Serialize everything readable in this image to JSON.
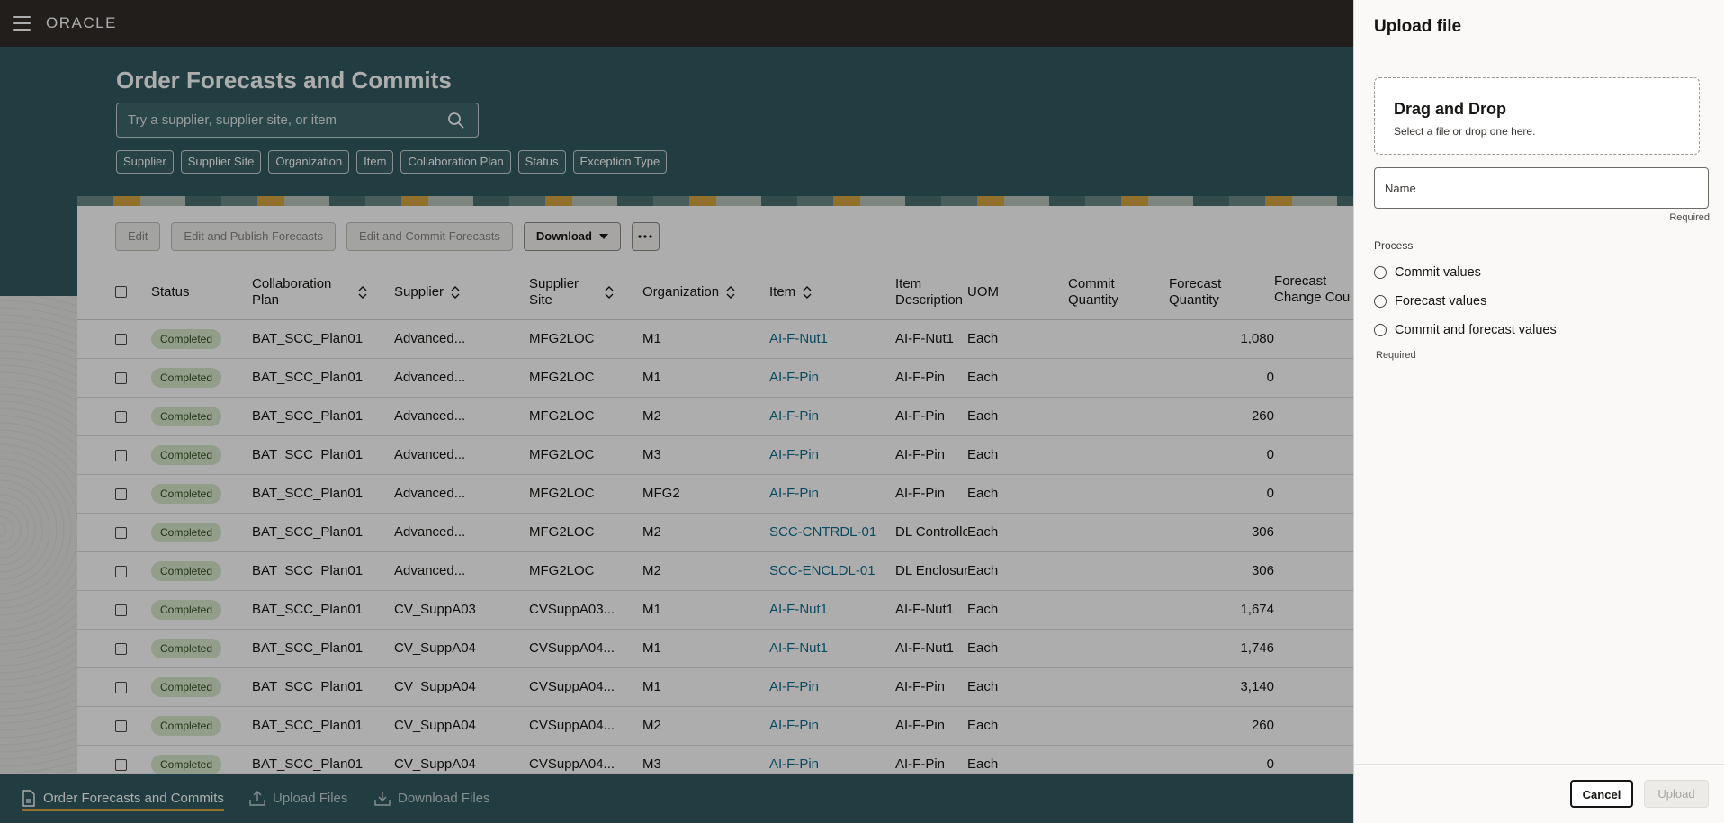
{
  "topbar": {
    "logo": "ORACLE"
  },
  "page": {
    "title": "Order Forecasts and Commits",
    "search_placeholder": "Try a supplier, supplier site, or item"
  },
  "filters": [
    "Supplier",
    "Supplier Site",
    "Organization",
    "Item",
    "Collaboration Plan",
    "Status",
    "Exception Type"
  ],
  "toolbar": {
    "edit": "Edit",
    "edit_publish": "Edit and Publish Forecasts",
    "edit_commit": "Edit and Commit Forecasts",
    "download": "Download"
  },
  "table": {
    "columns": {
      "status": "Status",
      "plan": "Collaboration Plan",
      "supplier": "Supplier",
      "site": "Supplier Site",
      "org": "Organization",
      "item": "Item",
      "desc": "Item Description",
      "uom": "UOM",
      "commit_qty": "Commit Quantity",
      "forecast_qty": "Forecast Quantity",
      "forecast_change": "Forecast Change Cou"
    },
    "rows": [
      {
        "status": "Completed",
        "plan": "BAT_SCC_Plan01",
        "supplier": "Advanced...",
        "site": "MFG2LOC",
        "org": "M1",
        "item": "AI-F-Nut1",
        "desc": "AI-F-Nut1",
        "uom": "Each",
        "forecast_qty": "1,080"
      },
      {
        "status": "Completed",
        "plan": "BAT_SCC_Plan01",
        "supplier": "Advanced...",
        "site": "MFG2LOC",
        "org": "M1",
        "item": "AI-F-Pin",
        "desc": "AI-F-Pin",
        "uom": "Each",
        "forecast_qty": "0"
      },
      {
        "status": "Completed",
        "plan": "BAT_SCC_Plan01",
        "supplier": "Advanced...",
        "site": "MFG2LOC",
        "org": "M2",
        "item": "AI-F-Pin",
        "desc": "AI-F-Pin",
        "uom": "Each",
        "forecast_qty": "260"
      },
      {
        "status": "Completed",
        "plan": "BAT_SCC_Plan01",
        "supplier": "Advanced...",
        "site": "MFG2LOC",
        "org": "M3",
        "item": "AI-F-Pin",
        "desc": "AI-F-Pin",
        "uom": "Each",
        "forecast_qty": "0"
      },
      {
        "status": "Completed",
        "plan": "BAT_SCC_Plan01",
        "supplier": "Advanced...",
        "site": "MFG2LOC",
        "org": "MFG2",
        "item": "AI-F-Pin",
        "desc": "AI-F-Pin",
        "uom": "Each",
        "forecast_qty": "0"
      },
      {
        "status": "Completed",
        "plan": "BAT_SCC_Plan01",
        "supplier": "Advanced...",
        "site": "MFG2LOC",
        "org": "M2",
        "item": "SCC-CNTRDL-01",
        "desc": "DL Controller",
        "uom": "Each",
        "forecast_qty": "306"
      },
      {
        "status": "Completed",
        "plan": "BAT_SCC_Plan01",
        "supplier": "Advanced...",
        "site": "MFG2LOC",
        "org": "M2",
        "item": "SCC-ENCLDL-01",
        "desc": "DL Enclosure",
        "uom": "Each",
        "forecast_qty": "306"
      },
      {
        "status": "Completed",
        "plan": "BAT_SCC_Plan01",
        "supplier": "CV_SuppA03",
        "site": "CVSuppA03...",
        "org": "M1",
        "item": "AI-F-Nut1",
        "desc": "AI-F-Nut1",
        "uom": "Each",
        "forecast_qty": "1,674"
      },
      {
        "status": "Completed",
        "plan": "BAT_SCC_Plan01",
        "supplier": "CV_SuppA04",
        "site": "CVSuppA04...",
        "org": "M1",
        "item": "AI-F-Nut1",
        "desc": "AI-F-Nut1",
        "uom": "Each",
        "forecast_qty": "1,746"
      },
      {
        "status": "Completed",
        "plan": "BAT_SCC_Plan01",
        "supplier": "CV_SuppA04",
        "site": "CVSuppA04...",
        "org": "M1",
        "item": "AI-F-Pin",
        "desc": "AI-F-Pin",
        "uom": "Each",
        "forecast_qty": "3,140"
      },
      {
        "status": "Completed",
        "plan": "BAT_SCC_Plan01",
        "supplier": "CV_SuppA04",
        "site": "CVSuppA04...",
        "org": "M2",
        "item": "AI-F-Pin",
        "desc": "AI-F-Pin",
        "uom": "Each",
        "forecast_qty": "260"
      },
      {
        "status": "Completed",
        "plan": "BAT_SCC_Plan01",
        "supplier": "CV_SuppA04",
        "site": "CVSuppA04...",
        "org": "M3",
        "item": "AI-F-Pin",
        "desc": "AI-F-Pin",
        "uom": "Each",
        "forecast_qty": "0"
      }
    ]
  },
  "bottom_nav": {
    "order_forecasts": "Order Forecasts and Commits",
    "upload_files": "Upload Files",
    "download_files": "Download Files"
  },
  "drawer": {
    "title": "Upload file",
    "dropzone_title": "Drag and Drop",
    "dropzone_sub": "Select a file or drop one here.",
    "name_placeholder": "Name",
    "name_required": "Required",
    "process_label": "Process",
    "options": [
      "Commit values",
      "Forecast values",
      "Commit and forecast values"
    ],
    "process_required": "Required",
    "cancel": "Cancel",
    "upload": "Upload"
  },
  "colors": {
    "topbar": "#312d2a",
    "hero": "#315a60",
    "link": "#0f6e8f",
    "badge": "#d7e7cc",
    "accent": "#d9a441"
  }
}
